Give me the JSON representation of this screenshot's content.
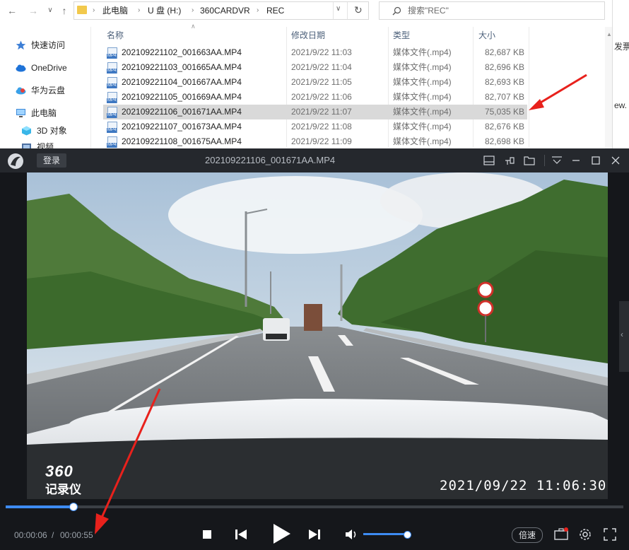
{
  "explorer": {
    "address": {
      "crumbs": [
        "此电脑",
        "U 盘 (H:)",
        "360CARDVR",
        "REC"
      ]
    },
    "search_placeholder": "搜索\"REC\"",
    "nav": [
      {
        "label": "快速访问",
        "icon": "star-icon"
      },
      {
        "label": "OneDrive",
        "icon": "cloud-icon"
      },
      {
        "label": "华为云盘",
        "icon": "huawei-cloud-icon"
      },
      {
        "label": "此电脑",
        "icon": "computer-icon"
      },
      {
        "label": "3D 对象",
        "icon": "cube-icon"
      },
      {
        "label": "视频",
        "icon": "video-folder-icon"
      }
    ],
    "columns": [
      "名称",
      "修改日期",
      "类型",
      "大小"
    ],
    "files": [
      {
        "name": "202109221102_001663AA.MP4",
        "date": "2021/9/22 11:03",
        "type": "媒体文件(.mp4)",
        "size": "82,687 KB",
        "selected": false
      },
      {
        "name": "202109221103_001665AA.MP4",
        "date": "2021/9/22 11:04",
        "type": "媒体文件(.mp4)",
        "size": "82,696 KB",
        "selected": false
      },
      {
        "name": "202109221104_001667AA.MP4",
        "date": "2021/9/22 11:05",
        "type": "媒体文件(.mp4)",
        "size": "82,693 KB",
        "selected": false
      },
      {
        "name": "202109221105_001669AA.MP4",
        "date": "2021/9/22 11:06",
        "type": "媒体文件(.mp4)",
        "size": "82,707 KB",
        "selected": false
      },
      {
        "name": "202109221106_001671AA.MP4",
        "date": "2021/9/22 11:07",
        "type": "媒体文件(.mp4)",
        "size": "75,035 KB",
        "selected": true
      },
      {
        "name": "202109221107_001673AA.MP4",
        "date": "2021/9/22 11:08",
        "type": "媒体文件(.mp4)",
        "size": "82,676 KB",
        "selected": false
      },
      {
        "name": "202109221108_001675AA.MP4",
        "date": "2021/9/22 11:09",
        "type": "媒体文件(.mp4)",
        "size": "82,698 KB",
        "selected": false
      }
    ],
    "edge_text": [
      "发票",
      "ew."
    ]
  },
  "player": {
    "login_label": "登录",
    "title": "202109221106_001671AA.MP4",
    "overlay": {
      "logo_line1": "360",
      "logo_line2": "记录仪",
      "timestamp": "2021/09/22 11:06:30"
    },
    "progress": 0.109,
    "volume": 1.0,
    "time": {
      "current": "00:00:06",
      "separator": "/",
      "total": "00:00:55"
    },
    "speed_label": "倍速",
    "colors": {
      "accent": "#3d8bf2",
      "annotation": "#e8211c"
    }
  }
}
